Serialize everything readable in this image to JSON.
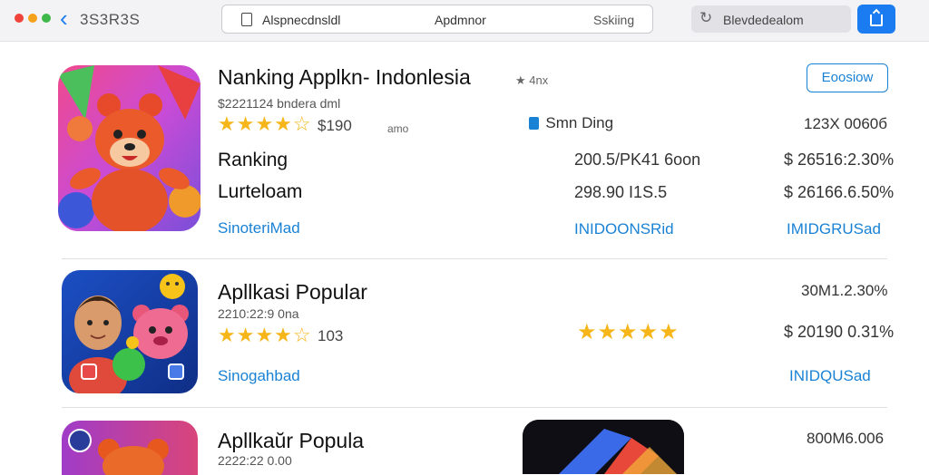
{
  "toolbar": {
    "nav_title": "3S3R3S",
    "url_left": "Alspnecdnsldl",
    "url_center": "Apdmnor",
    "url_right": "Sskiing",
    "search_placeholder": "Blevdedealom"
  },
  "apps": [
    {
      "title": "Nanking Applkn- Indonlesia",
      "title_tag": "4nx",
      "subtitle": "$2221124 bndera dml",
      "stars": "★★★★☆",
      "rating": "190",
      "rating_prefix": "$",
      "extra": "amo",
      "mid_label": " Smn Ding",
      "right_top": "123X 0060б",
      "label1": "Ranking",
      "value1": "200.5/PK41 6oon",
      "price1": "$ 26516:2.30%",
      "label2": "Lurteloam",
      "value2": "298.90 I1S.5",
      "price2": "$ 26166.6.50%",
      "link_left": "SinoteriMad",
      "link_mid": "INIDOONSRid",
      "link_right": "IMIDGRUSad",
      "button": "Eoosiow"
    },
    {
      "title": "Apllkasi Popular",
      "subtitle": "2210:22:9 0na",
      "stars": "★★★★☆",
      "rating": "103",
      "right_top": "30M1.2.30%",
      "mid_stars": "★★★★★",
      "price1": "$ 20190 0.31%",
      "link_left": "Sinogahbad",
      "link_right": "INIDQUSad"
    },
    {
      "title": "Apllkaŭr Popula",
      "subtitle": "2222:22 0.00",
      "right_top": "800M6.006"
    }
  ],
  "colors": {
    "accent": "#1a7cf0",
    "star": "#f6b61a",
    "link": "#1a82d4"
  }
}
